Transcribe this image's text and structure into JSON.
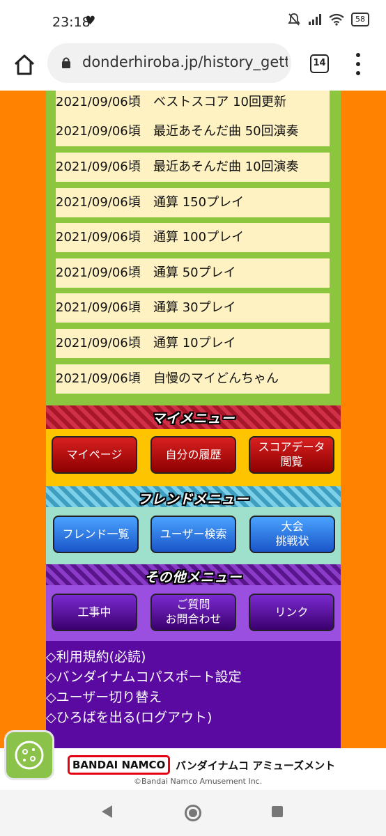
{
  "status": {
    "time": "23:18",
    "battery": "58"
  },
  "browser": {
    "url": "donderhiroba.jp/history_getti",
    "tab_count": "14"
  },
  "history": [
    {
      "date": "2021/09/06頃",
      "text": "ベストスコア 10回更新"
    },
    {
      "date": "2021/09/06頃",
      "text": "最近あそんだ曲 50回演奏"
    },
    {
      "date": "2021/09/06頃",
      "text": "最近あそんだ曲 10回演奏"
    },
    {
      "date": "2021/09/06頃",
      "text": "通算 150プレイ"
    },
    {
      "date": "2021/09/06頃",
      "text": "通算 100プレイ"
    },
    {
      "date": "2021/09/06頃",
      "text": "通算 50プレイ"
    },
    {
      "date": "2021/09/06頃",
      "text": "通算 30プレイ"
    },
    {
      "date": "2021/09/06頃",
      "text": "通算 10プレイ"
    },
    {
      "date": "2021/09/06頃",
      "text": "自慢のマイどんちゃん"
    }
  ],
  "my_menu": {
    "title": "マイメニュー",
    "buttons": [
      "マイページ",
      "自分の履歴",
      "スコアデータ\n閲覧"
    ]
  },
  "friend_menu": {
    "title": "フレンドメニュー",
    "buttons": [
      "フレンド一覧",
      "ユーザー検索",
      "大会\n挑戦状"
    ]
  },
  "other_menu": {
    "title": "その他メニュー",
    "buttons": [
      "工事中",
      "ご質問\nお問合わせ",
      "リンク"
    ]
  },
  "links": [
    "◇利用規約(必読)",
    "◇バンダイナムコパスポート設定",
    "◇ユーザー切り替え",
    "◇ひろばを出る(ログアウト)"
  ],
  "footer": {
    "logo": "BANDAI NAMCO",
    "company_jp": "バンダイナムコ アミューズメント",
    "copyright": "©Bandai Namco Amusement Inc."
  },
  "colors": {
    "background": "#ff8200",
    "history_panel": "#8cc63f",
    "history_item": "#fff2c2",
    "my_menu_body": "#ffc400",
    "friend_menu_body": "#9ee0cc",
    "other_menu_body": "#9b4fe0",
    "links_body": "#5a0aa0"
  }
}
